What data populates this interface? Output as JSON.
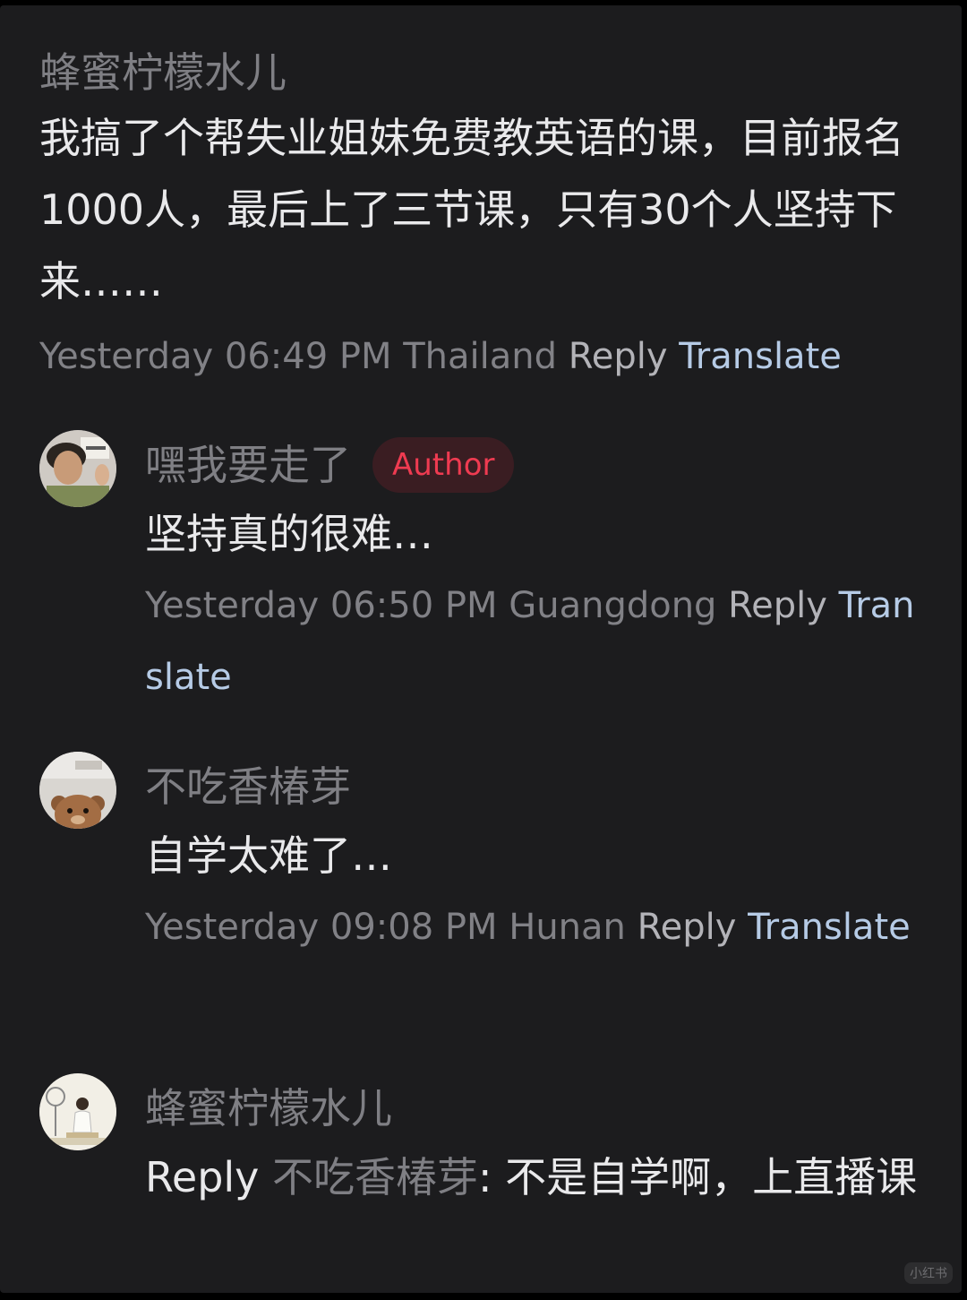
{
  "main_comment": {
    "user": "蜂蜜柠檬水儿",
    "text": "我搞了个帮失业姐妹免费教英语的课，目前报名1000人，最后上了三节课，只有30个人坚持下来……",
    "time": "Yesterday 06:49 PM",
    "location": "Thailand",
    "reply_label": "Reply",
    "translate_label": "Translate"
  },
  "replies": [
    {
      "user": "嘿我要走了",
      "badge": "Author",
      "text": "坚持真的很难…",
      "time": "Yesterday 06:50 PM",
      "location": "Guangdong",
      "reply_label": "Reply",
      "translate_label": "Translate"
    },
    {
      "user": "不吃香椿芽",
      "text": "自学太难了…",
      "time": "Yesterday 09:08 PM",
      "location": "Hunan",
      "reply_label": "Reply",
      "translate_label": "Translate"
    },
    {
      "user": "蜂蜜柠檬水儿",
      "reply_prefix": "Reply",
      "reply_target": "不吃香椿芽",
      "text": ": 不是自学啊，上直播课"
    }
  ],
  "watermark": "小红书",
  "colors": {
    "background": "#1c1c1e",
    "author_badge_bg": "#3a1d22",
    "author_badge_text": "#ef3b51",
    "translate_link": "#b6cbe6"
  }
}
